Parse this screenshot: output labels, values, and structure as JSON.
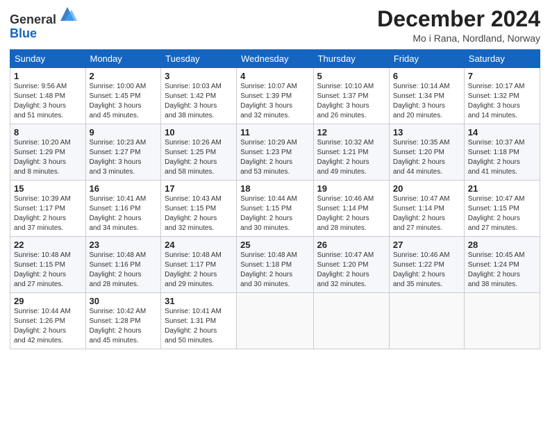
{
  "header": {
    "logo_general": "General",
    "logo_blue": "Blue",
    "month_title": "December 2024",
    "location": "Mo i Rana, Nordland, Norway"
  },
  "calendar": {
    "headers": [
      "Sunday",
      "Monday",
      "Tuesday",
      "Wednesday",
      "Thursday",
      "Friday",
      "Saturday"
    ],
    "weeks": [
      [
        {
          "day": "1",
          "info": "Sunrise: 9:56 AM\nSunset: 1:48 PM\nDaylight: 3 hours\nand 51 minutes."
        },
        {
          "day": "2",
          "info": "Sunrise: 10:00 AM\nSunset: 1:45 PM\nDaylight: 3 hours\nand 45 minutes."
        },
        {
          "day": "3",
          "info": "Sunrise: 10:03 AM\nSunset: 1:42 PM\nDaylight: 3 hours\nand 38 minutes."
        },
        {
          "day": "4",
          "info": "Sunrise: 10:07 AM\nSunset: 1:39 PM\nDaylight: 3 hours\nand 32 minutes."
        },
        {
          "day": "5",
          "info": "Sunrise: 10:10 AM\nSunset: 1:37 PM\nDaylight: 3 hours\nand 26 minutes."
        },
        {
          "day": "6",
          "info": "Sunrise: 10:14 AM\nSunset: 1:34 PM\nDaylight: 3 hours\nand 20 minutes."
        },
        {
          "day": "7",
          "info": "Sunrise: 10:17 AM\nSunset: 1:32 PM\nDaylight: 3 hours\nand 14 minutes."
        }
      ],
      [
        {
          "day": "8",
          "info": "Sunrise: 10:20 AM\nSunset: 1:29 PM\nDaylight: 3 hours\nand 8 minutes."
        },
        {
          "day": "9",
          "info": "Sunrise: 10:23 AM\nSunset: 1:27 PM\nDaylight: 3 hours\nand 3 minutes."
        },
        {
          "day": "10",
          "info": "Sunrise: 10:26 AM\nSunset: 1:25 PM\nDaylight: 2 hours\nand 58 minutes."
        },
        {
          "day": "11",
          "info": "Sunrise: 10:29 AM\nSunset: 1:23 PM\nDaylight: 2 hours\nand 53 minutes."
        },
        {
          "day": "12",
          "info": "Sunrise: 10:32 AM\nSunset: 1:21 PM\nDaylight: 2 hours\nand 49 minutes."
        },
        {
          "day": "13",
          "info": "Sunrise: 10:35 AM\nSunset: 1:20 PM\nDaylight: 2 hours\nand 44 minutes."
        },
        {
          "day": "14",
          "info": "Sunrise: 10:37 AM\nSunset: 1:18 PM\nDaylight: 2 hours\nand 41 minutes."
        }
      ],
      [
        {
          "day": "15",
          "info": "Sunrise: 10:39 AM\nSunset: 1:17 PM\nDaylight: 2 hours\nand 37 minutes."
        },
        {
          "day": "16",
          "info": "Sunrise: 10:41 AM\nSunset: 1:16 PM\nDaylight: 2 hours\nand 34 minutes."
        },
        {
          "day": "17",
          "info": "Sunrise: 10:43 AM\nSunset: 1:15 PM\nDaylight: 2 hours\nand 32 minutes."
        },
        {
          "day": "18",
          "info": "Sunrise: 10:44 AM\nSunset: 1:15 PM\nDaylight: 2 hours\nand 30 minutes."
        },
        {
          "day": "19",
          "info": "Sunrise: 10:46 AM\nSunset: 1:14 PM\nDaylight: 2 hours\nand 28 minutes."
        },
        {
          "day": "20",
          "info": "Sunrise: 10:47 AM\nSunset: 1:14 PM\nDaylight: 2 hours\nand 27 minutes."
        },
        {
          "day": "21",
          "info": "Sunrise: 10:47 AM\nSunset: 1:15 PM\nDaylight: 2 hours\nand 27 minutes."
        }
      ],
      [
        {
          "day": "22",
          "info": "Sunrise: 10:48 AM\nSunset: 1:15 PM\nDaylight: 2 hours\nand 27 minutes."
        },
        {
          "day": "23",
          "info": "Sunrise: 10:48 AM\nSunset: 1:16 PM\nDaylight: 2 hours\nand 28 minutes."
        },
        {
          "day": "24",
          "info": "Sunrise: 10:48 AM\nSunset: 1:17 PM\nDaylight: 2 hours\nand 29 minutes."
        },
        {
          "day": "25",
          "info": "Sunrise: 10:48 AM\nSunset: 1:18 PM\nDaylight: 2 hours\nand 30 minutes."
        },
        {
          "day": "26",
          "info": "Sunrise: 10:47 AM\nSunset: 1:20 PM\nDaylight: 2 hours\nand 32 minutes."
        },
        {
          "day": "27",
          "info": "Sunrise: 10:46 AM\nSunset: 1:22 PM\nDaylight: 2 hours\nand 35 minutes."
        },
        {
          "day": "28",
          "info": "Sunrise: 10:45 AM\nSunset: 1:24 PM\nDaylight: 2 hours\nand 38 minutes."
        }
      ],
      [
        {
          "day": "29",
          "info": "Sunrise: 10:44 AM\nSunset: 1:26 PM\nDaylight: 2 hours\nand 42 minutes."
        },
        {
          "day": "30",
          "info": "Sunrise: 10:42 AM\nSunset: 1:28 PM\nDaylight: 2 hours\nand 45 minutes."
        },
        {
          "day": "31",
          "info": "Sunrise: 10:41 AM\nSunset: 1:31 PM\nDaylight: 2 hours\nand 50 minutes."
        },
        {
          "day": "",
          "info": ""
        },
        {
          "day": "",
          "info": ""
        },
        {
          "day": "",
          "info": ""
        },
        {
          "day": "",
          "info": ""
        }
      ]
    ]
  }
}
